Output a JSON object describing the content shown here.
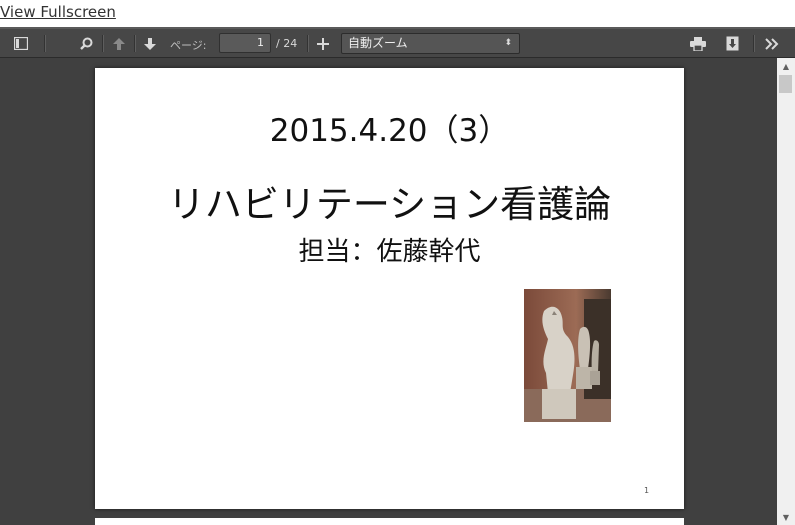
{
  "fullscreen_link": "View Fullscreen",
  "toolbar": {
    "page_label": "ページ:",
    "page_value": "1",
    "page_count": "/ 24",
    "zoom_value": "自動ズーム",
    "zoom_arrow": "⬍"
  },
  "slide": {
    "date": "2015.4.20（3）",
    "title": "リハビリテーション看護論",
    "subtitle": "担当：佐藤幹代",
    "page_number": "1"
  },
  "icons": {
    "sidebar": "sidebar-toggle-icon",
    "search": "search-icon",
    "prev": "arrow-up-icon",
    "next": "arrow-down-icon",
    "zoom_in": "plus-icon",
    "print": "print-icon",
    "download": "download-icon",
    "tools": "double-chevron-right-icon"
  },
  "colors": {
    "toolbar_bg": "#474747",
    "viewer_bg": "#404040",
    "page_bg": "#ffffff"
  }
}
